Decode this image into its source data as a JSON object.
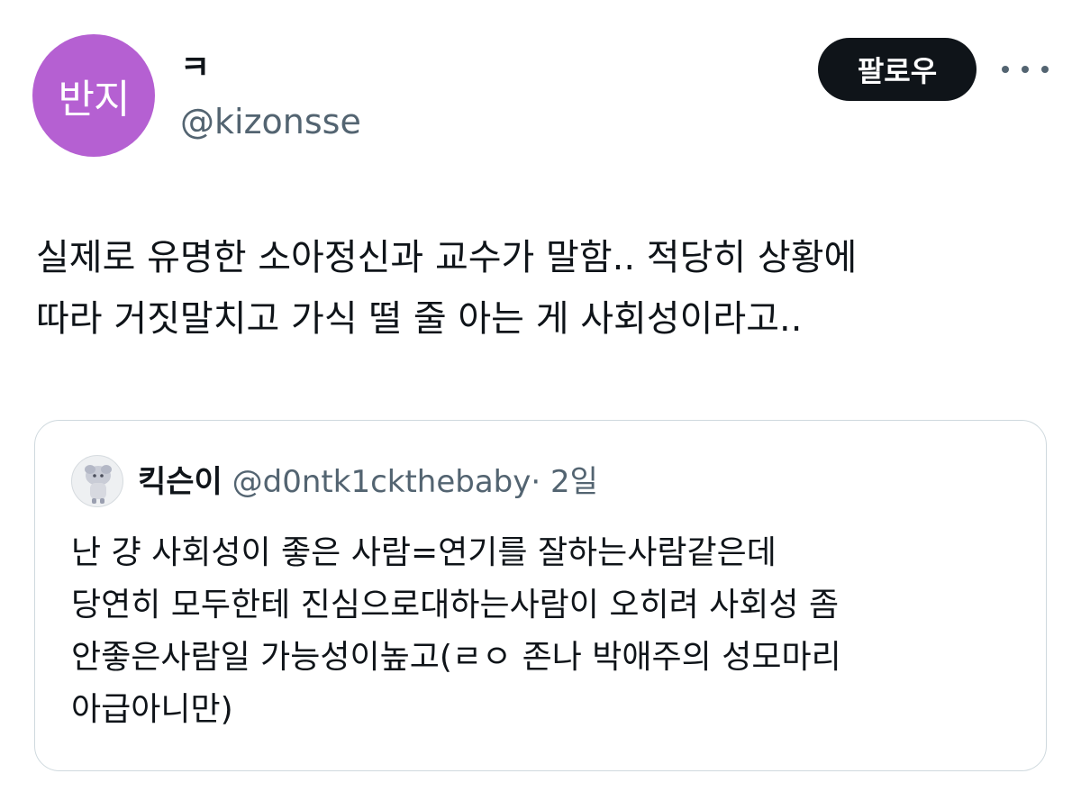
{
  "author": {
    "avatar_text": "반지",
    "avatar_color": "#b560d2",
    "display_name": "ㅋ",
    "handle": "@kizonsse"
  },
  "actions": {
    "follow_label": "팔로우",
    "more_icon": "more-horizontal-icon"
  },
  "tweet": {
    "lines": [
      "실제로 유명한 소아정신과 교수가 말함.. 적당히 상황에",
      "따라 거짓말치고 가식 떨 줄 아는 게 사회성이라고.."
    ]
  },
  "quoted": {
    "avatar_icon": "character-avatar-icon",
    "name": "킥슨이",
    "handle": "@d0ntk1ckthebaby",
    "separator": "·",
    "time": "2일",
    "lines": [
      "난 걍 사회성이 좋은 사람=연기를 잘하는사람같은데",
      "당연히 모두한테 진심으로대하는사람이 오히려 사회성 좀",
      "안좋은사람일 가능성이높고(ㄹㅇ 존나 박애주의 성모마리",
      "아급아니만)"
    ]
  }
}
